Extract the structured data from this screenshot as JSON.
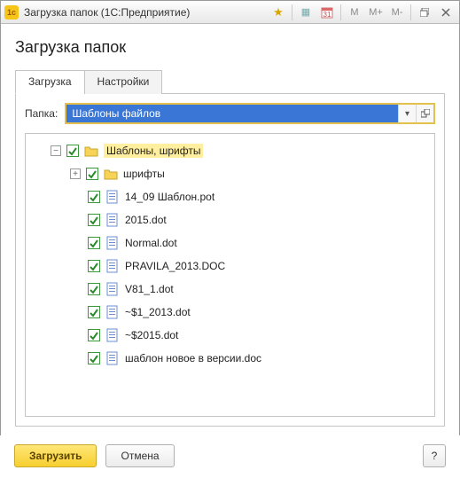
{
  "window": {
    "title": "Загрузка папок  (1С:Предприятие)"
  },
  "page": {
    "title": "Загрузка папок"
  },
  "tabs": [
    {
      "label": "Загрузка",
      "active": true
    },
    {
      "label": "Настройки",
      "active": false
    }
  ],
  "folder_field": {
    "label": "Папка:",
    "value": "Шаблоны файлов"
  },
  "tree": {
    "root": {
      "label": "Шаблоны, шрифты",
      "checked": true,
      "highlight": true,
      "children": [
        {
          "label": "шрифты",
          "type": "folder",
          "checked": true,
          "expandable": true
        },
        {
          "label": "14_09 Шаблон.pot",
          "type": "file",
          "checked": true
        },
        {
          "label": "2015.dot",
          "type": "file",
          "checked": true
        },
        {
          "label": "Normal.dot",
          "type": "file",
          "checked": true
        },
        {
          "label": "PRAVILA_2013.DOC",
          "type": "file",
          "checked": true
        },
        {
          "label": "V81_1.dot",
          "type": "file",
          "checked": true
        },
        {
          "label": "~$1_2013.dot",
          "type": "file",
          "checked": true
        },
        {
          "label": "~$2015.dot",
          "type": "file",
          "checked": true
        },
        {
          "label": "шаблон новое в версии.doc",
          "type": "file",
          "checked": true
        }
      ]
    }
  },
  "buttons": {
    "load": "Загрузить",
    "cancel": "Отмена",
    "help": "?"
  },
  "toolbar_icons": {
    "m": "M",
    "mplus": "M+",
    "mminus": "M-"
  }
}
